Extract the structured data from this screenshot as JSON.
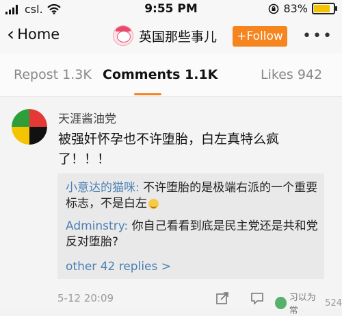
{
  "status_bar": {
    "carrier": "csl.",
    "time": "9:55 PM",
    "battery_percent": "83%",
    "battery_level": 0.83,
    "battery_color": "#f4c400"
  },
  "nav": {
    "back_label": "Home",
    "account_name": "英国那些事儿",
    "follow_label": "+Follow",
    "follow_color": "#f6841f"
  },
  "tabs": {
    "repost": "Repost 1.3K",
    "comments": "Comments 1.1K",
    "likes": "Likes 942"
  },
  "comment": {
    "username": "天涯酱油党",
    "text": "被强奸怀孕也不许堕胎，白左真特么疯了！！！",
    "date": "5-12 20:09"
  },
  "replies": [
    {
      "name": "小意达的猫咪:",
      "text": " 不许堕胎的是极端右派的一个重要标志，不是白左"
    },
    {
      "name": "Adminstry:",
      "text": " 你自己看看到底是民主党还是共和党反对堕胎?"
    }
  ],
  "more_replies": "other 42 replies >",
  "actions": {
    "like_count": "524"
  },
  "watermark": "习以为常",
  "icons": {
    "signal": "signal-bars-icon",
    "wifi": "wifi-icon",
    "lock_rotation": "rotation-lock-icon",
    "back": "chevron-left-icon",
    "more": "more-dots-icon",
    "share": "share-icon",
    "comment": "comment-icon",
    "like": "thumbs-up-icon"
  },
  "colors": {
    "accent": "#f6841f",
    "link": "#4a7fb5"
  }
}
